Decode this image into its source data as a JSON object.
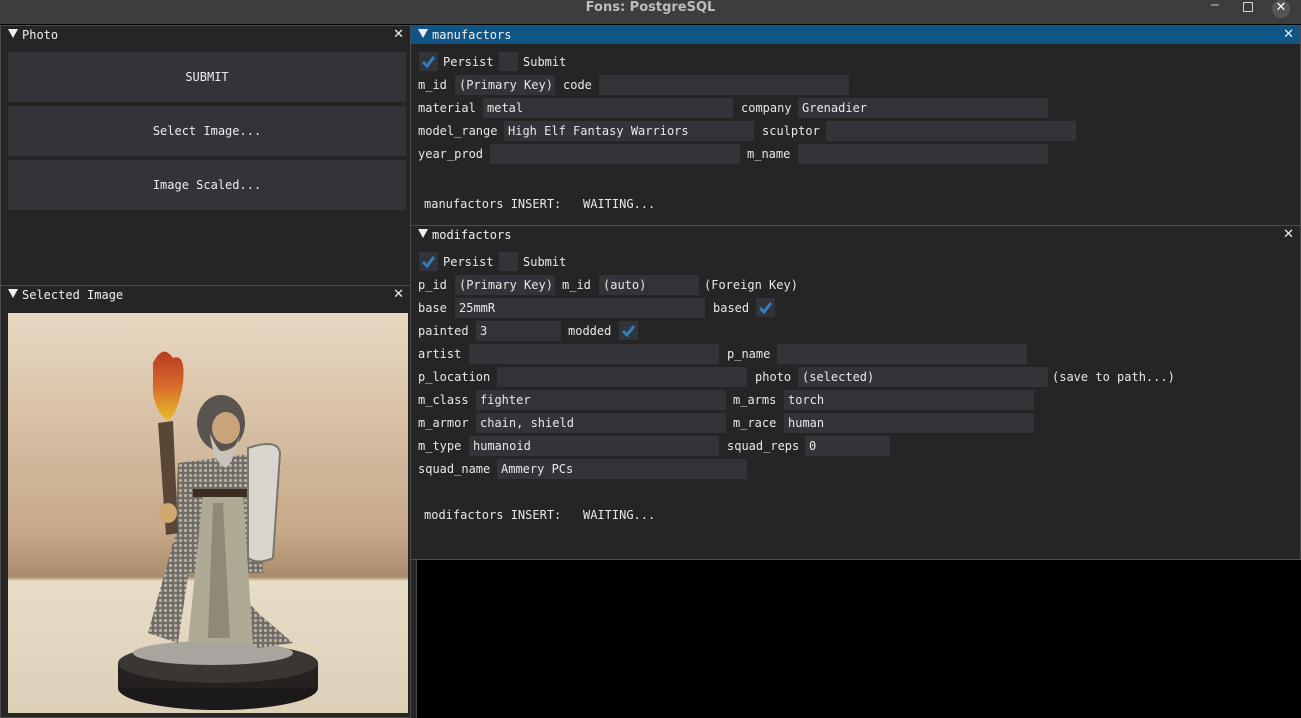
{
  "window": {
    "title": "Fons: PostgreSQL",
    "controls": {
      "minimize": "—",
      "maximize": "□",
      "close": "✕"
    }
  },
  "photo_panel": {
    "title": "Photo",
    "close": "✕",
    "buttons": [
      "SUBMIT",
      "Select Image...",
      "Image Scaled..."
    ]
  },
  "selected_image_panel": {
    "title": "Selected Image",
    "close": "✕",
    "image_description": "Painted miniature figure: bearded fighter in chainmail holding a torch and shield on a black round base"
  },
  "manufactors": {
    "title": "manufactors",
    "close": "✕",
    "persist": {
      "label": "Persist",
      "checked": true
    },
    "submit": {
      "label": "Submit",
      "checked": false
    },
    "fields": {
      "m_id": {
        "label": "m_id",
        "value": "(Primary Key)"
      },
      "code": {
        "label": "code",
        "value": ""
      },
      "material": {
        "label": "material",
        "value": "metal"
      },
      "company": {
        "label": "company",
        "value": "Grenadier"
      },
      "model_range": {
        "label": "model_range",
        "value": "High Elf Fantasy Warriors"
      },
      "sculptor": {
        "label": "sculptor",
        "value": ""
      },
      "year_prod": {
        "label": "year_prod",
        "value": ""
      },
      "m_name": {
        "label": "m_name",
        "value": ""
      }
    },
    "status_label": "manufactors INSERT:",
    "status_value": "WAITING..."
  },
  "modifactors": {
    "title": "modifactors",
    "close": "✕",
    "persist": {
      "label": "Persist",
      "checked": true
    },
    "submit": {
      "label": "Submit",
      "checked": false
    },
    "fields": {
      "p_id": {
        "label": "p_id",
        "value": "(Primary Key)"
      },
      "m_id": {
        "label": "m_id",
        "value": "(auto)",
        "note": "(Foreign Key)"
      },
      "base": {
        "label": "base",
        "value": "25mmR"
      },
      "based": {
        "label": "based",
        "checked": true
      },
      "painted": {
        "label": "painted",
        "value": "3"
      },
      "modded": {
        "label": "modded",
        "checked": true
      },
      "artist": {
        "label": "artist",
        "value": ""
      },
      "p_name": {
        "label": "p_name",
        "value": ""
      },
      "p_location": {
        "label": "p_location",
        "value": ""
      },
      "photo": {
        "label": "photo",
        "value": "(selected)",
        "note": "(save to path...)"
      },
      "m_class": {
        "label": "m_class",
        "value": "fighter"
      },
      "m_arms": {
        "label": "m_arms",
        "value": "torch"
      },
      "m_armor": {
        "label": "m_armor",
        "value": "chain, shield"
      },
      "m_race": {
        "label": "m_race",
        "value": "human"
      },
      "m_type": {
        "label": "m_type",
        "value": "humanoid"
      },
      "squad_reps": {
        "label": "squad_reps",
        "value": "0"
      },
      "squad_name": {
        "label": "squad_name",
        "value": "Ammery PCs"
      }
    },
    "status_label": "modifactors INSERT:",
    "status_value": "WAITING..."
  },
  "colors": {
    "accent": "#0f5687",
    "check": "#2f7fc1",
    "panel_bg": "#252525",
    "field_bg": "#33333a"
  }
}
